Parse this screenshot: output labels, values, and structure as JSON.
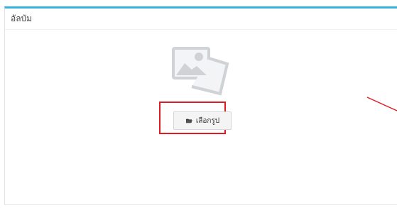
{
  "panel": {
    "title": "อัลบัม"
  },
  "upload": {
    "button_label": "เลือกรูป",
    "button_icon": "folder-open-icon",
    "placeholder_icon": "image-placeholder-icon"
  },
  "annotation": {
    "highlight_color": "#e01b24",
    "accent_color": "#35b4df"
  }
}
